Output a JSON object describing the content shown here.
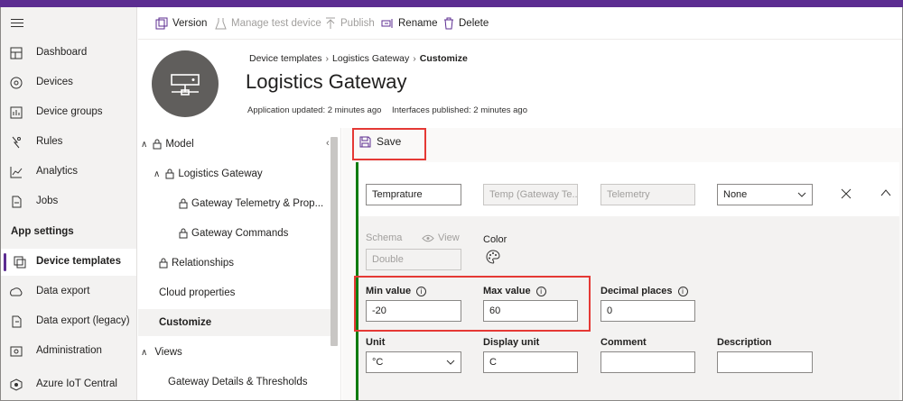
{
  "toolbar": {
    "version": "Version",
    "manage_test_device": "Manage test device",
    "publish": "Publish",
    "rename": "Rename",
    "delete": "Delete"
  },
  "nav": {
    "items": [
      {
        "label": "Dashboard",
        "icon": "dashboard-icon"
      },
      {
        "label": "Devices",
        "icon": "devices-icon"
      },
      {
        "label": "Device groups",
        "icon": "device-groups-icon"
      },
      {
        "label": "Rules",
        "icon": "rules-icon"
      },
      {
        "label": "Analytics",
        "icon": "analytics-icon"
      },
      {
        "label": "Jobs",
        "icon": "jobs-icon"
      }
    ],
    "section_title": "App settings",
    "settings_items": [
      {
        "label": "Device templates",
        "icon": "device-templates-icon",
        "active": true
      },
      {
        "label": "Data export",
        "icon": "data-export-icon"
      },
      {
        "label": "Data export (legacy)",
        "icon": "data-export-legacy-icon"
      },
      {
        "label": "Administration",
        "icon": "administration-icon"
      },
      {
        "label": "Azure IoT Central",
        "icon": "iot-central-icon"
      }
    ]
  },
  "breadcrumb": {
    "items": [
      "Device templates",
      "Logistics Gateway"
    ],
    "current": "Customize"
  },
  "header": {
    "title": "Logistics Gateway",
    "app_updated": "Application updated: 2 minutes ago",
    "interfaces_published": "Interfaces published: 2 minutes ago"
  },
  "tree": {
    "model": "Model",
    "logistics_gateway": "Logistics Gateway",
    "gateway_telemetry": "Gateway Telemetry & Prop...",
    "gateway_commands": "Gateway Commands",
    "relationships": "Relationships",
    "cloud_properties": "Cloud properties",
    "customize": "Customize",
    "views": "Views",
    "gateway_details": "Gateway Details & Thresholds"
  },
  "main": {
    "save_label": "Save",
    "name_value": "Temprature",
    "display_name_value": "Temp (Gateway Te...",
    "capability_type": "Telemetry",
    "semantic_type": "None",
    "schema_label": "Schema",
    "view_label": "View",
    "schema_value": "Double",
    "color_label": "Color",
    "min_label": "Min value",
    "min_value": "-20",
    "max_label": "Max value",
    "max_value": "60",
    "decimal_label": "Decimal places",
    "decimal_value": "0",
    "unit_label": "Unit",
    "unit_value": "°C",
    "display_unit_label": "Display unit",
    "display_unit_value": "C",
    "comment_label": "Comment",
    "comment_value": "",
    "description_label": "Description",
    "description_value": ""
  },
  "colors": {
    "accent": "#5c2d91",
    "green": "#107c10",
    "highlight": "#e53935"
  }
}
